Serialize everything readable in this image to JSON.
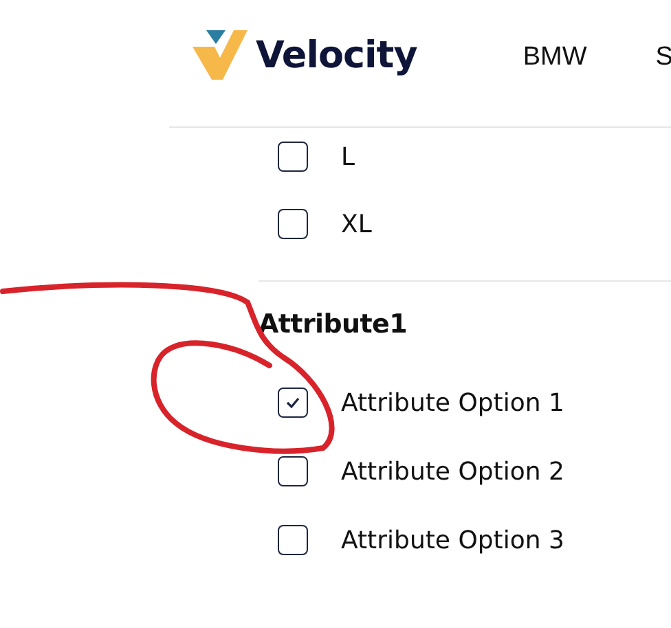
{
  "header": {
    "logo": "Velocity",
    "nav": [
      "BMW",
      "S"
    ]
  },
  "size_options": [
    {
      "label": "L",
      "checked": false
    },
    {
      "label": "XL",
      "checked": false
    }
  ],
  "attribute_group": {
    "title": "Attribute1",
    "options": [
      {
        "label": "Attribute Option 1",
        "checked": true
      },
      {
        "label": "Attribute Option 2",
        "checked": false
      },
      {
        "label": "Attribute Option 3",
        "checked": false
      }
    ]
  },
  "annotation": {
    "kind": "scribble"
  }
}
